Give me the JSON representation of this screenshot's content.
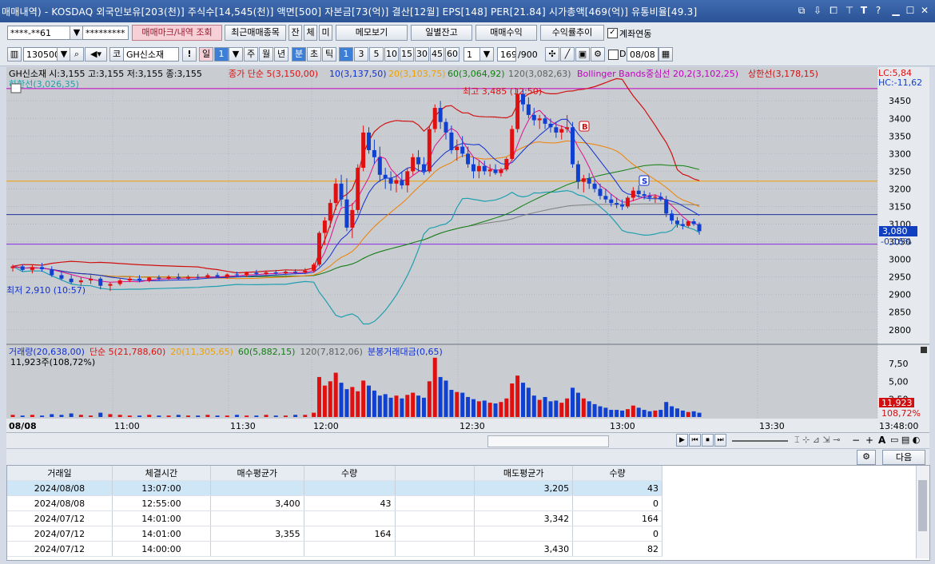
{
  "titlebar": {
    "text": "매매내역) - KOSDAQ 외국인보유[203(천)] 주식수[14,545(천)] 액면[500] 자본금[73(억)] 결산[12월] EPS[148] PER[21.84] 시가총액[469(억)] 유통비율[49.3]"
  },
  "toolbar1": {
    "account_no": "****-**61",
    "password": "*********",
    "btn_trade_mark": "매매마크/내역 조회",
    "btn_recent": "최근매매종목",
    "btn_jan": "잔",
    "btn_che": "체",
    "btn_mi": "미",
    "btn_memo": "메모보기",
    "btn_daily": "일별잔고",
    "btn_profit": "매매수익",
    "btn_trend": "수익률추이",
    "chk_link": "계좌연동"
  },
  "toolbar2": {
    "code": "130500",
    "market": "코",
    "name": "GH신소재",
    "exclam": "!",
    "period_day": "일",
    "period_num": "1",
    "periods": [
      "주",
      "월",
      "년",
      "분",
      "초",
      "틱"
    ],
    "minutes": [
      "1",
      "3",
      "5",
      "10",
      "15",
      "30",
      "45",
      "60"
    ],
    "interval": "1",
    "count": "169",
    "count_total": "/900",
    "chk_d": "D",
    "date": "08/08"
  },
  "chart_header": {
    "name": "GH신소재",
    "ohlc": "시:3,155 고:3,155 저:3,155 종:3,155",
    "ma5": "종가 단순 5(3,150,00)",
    "ma10": "10(3,137,50)",
    "ma20": "20(3,103,75)",
    "ma60": "60(3,064,92)",
    "ma120": "120(3,082,63)",
    "bb": "Bollinger Bands중심선 20,2(3,102,25)",
    "upper_limit": "상한선(3,178,15)",
    "lower_limit": "하한선(3,026,35)",
    "lc": "LC:5,84",
    "hc": "HC:-11,62",
    "high_label": "최고 3,485 (12:50)",
    "low_label": "최저 2,910 (10:57)",
    "buy_mark": "B",
    "sell_mark": "S",
    "current_price": "3,080",
    "current_change": "-0,16%"
  },
  "volume_header": {
    "volume": "거래량(20,638,00)",
    "vma5": "단순 5(21,788,60)",
    "vma20": "20(11,305,65)",
    "vma60": "60(5,882,15)",
    "vma120": "120(7,812,06)",
    "amount": "분봉거래대금(0,65)",
    "sub": "11,923주(108,72%)",
    "current_vol": "11,923",
    "current_ratio": "108,72%"
  },
  "chart_data": {
    "type": "candlestick",
    "date_label": "08/08",
    "x_ticks": [
      "11:00",
      "11:30",
      "12:00",
      "12:30",
      "13:00",
      "13:30",
      "13:48:00"
    ],
    "y_ticks": [
      3450,
      3400,
      3350,
      3300,
      3250,
      3200,
      3150,
      3100,
      3050,
      3000,
      2950,
      2900,
      2850,
      2800
    ],
    "y_range": [
      2770,
      3505
    ],
    "vol_ticks": [
      "7,50",
      "5,00",
      "2,50"
    ],
    "vol_range": [
      0,
      8.5
    ],
    "hlines": [
      {
        "value": 3485,
        "color": "#c000c0"
      },
      {
        "value": 3222,
        "color": "#f0a000"
      },
      {
        "value": 3127,
        "color": "#2030a0"
      },
      {
        "value": 3043,
        "color": "#8a2be2"
      }
    ],
    "ohlc": [
      [
        2975,
        2985,
        2965,
        2980
      ],
      [
        2980,
        2985,
        2965,
        2970
      ],
      [
        2970,
        2985,
        2960,
        2978
      ],
      [
        2978,
        2990,
        2965,
        2972
      ],
      [
        2972,
        2980,
        2950,
        2955
      ],
      [
        2955,
        2965,
        2940,
        2945
      ],
      [
        2945,
        2955,
        2930,
        2935
      ],
      [
        2935,
        2950,
        2925,
        2940
      ],
      [
        2940,
        2955,
        2930,
        2945
      ],
      [
        2945,
        2950,
        2915,
        2925
      ],
      [
        2925,
        2935,
        2910,
        2930
      ],
      [
        2930,
        2945,
        2925,
        2940
      ],
      [
        2940,
        2950,
        2935,
        2945
      ],
      [
        2945,
        2955,
        2935,
        2940
      ],
      [
        2940,
        2950,
        2935,
        2948
      ],
      [
        2948,
        2955,
        2940,
        2945
      ],
      [
        2945,
        2955,
        2940,
        2950
      ],
      [
        2950,
        2960,
        2940,
        2945
      ],
      [
        2945,
        2955,
        2940,
        2950
      ],
      [
        2950,
        2958,
        2942,
        2948
      ],
      [
        2948,
        2960,
        2945,
        2955
      ],
      [
        2955,
        2962,
        2948,
        2950
      ],
      [
        2950,
        2960,
        2945,
        2957
      ],
      [
        2957,
        2965,
        2950,
        2955
      ],
      [
        2955,
        2965,
        2950,
        2962
      ],
      [
        2962,
        2970,
        2955,
        2958
      ],
      [
        2958,
        2968,
        2952,
        2963
      ],
      [
        2963,
        2970,
        2955,
        2960
      ],
      [
        2960,
        2968,
        2955,
        2965
      ],
      [
        2965,
        2972,
        2958,
        2962
      ],
      [
        2962,
        2975,
        2958,
        2968
      ],
      [
        2968,
        2990,
        2962,
        2985
      ],
      [
        2985,
        3080,
        2980,
        3075
      ],
      [
        3075,
        3120,
        3040,
        3110
      ],
      [
        3110,
        3170,
        3090,
        3160
      ],
      [
        3160,
        3230,
        3140,
        3215
      ],
      [
        3215,
        3240,
        3150,
        3170
      ],
      [
        3170,
        3230,
        3080,
        3090
      ],
      [
        3090,
        3160,
        3060,
        3140
      ],
      [
        3140,
        3270,
        3130,
        3260
      ],
      [
        3260,
        3380,
        3250,
        3360
      ],
      [
        3360,
        3375,
        3300,
        3310
      ],
      [
        3310,
        3340,
        3270,
        3290
      ],
      [
        3290,
        3320,
        3220,
        3240
      ],
      [
        3240,
        3260,
        3200,
        3230
      ],
      [
        3230,
        3250,
        3195,
        3215
      ],
      [
        3215,
        3240,
        3190,
        3225
      ],
      [
        3225,
        3250,
        3200,
        3210
      ],
      [
        3210,
        3260,
        3190,
        3250
      ],
      [
        3250,
        3300,
        3240,
        3290
      ],
      [
        3290,
        3310,
        3250,
        3270
      ],
      [
        3270,
        3290,
        3240,
        3250
      ],
      [
        3250,
        3380,
        3245,
        3370
      ],
      [
        3370,
        3440,
        3360,
        3430
      ],
      [
        3430,
        3450,
        3370,
        3390
      ],
      [
        3390,
        3400,
        3340,
        3360
      ],
      [
        3360,
        3380,
        3300,
        3310
      ],
      [
        3310,
        3340,
        3280,
        3320
      ],
      [
        3320,
        3350,
        3290,
        3300
      ],
      [
        3300,
        3320,
        3260,
        3270
      ],
      [
        3270,
        3290,
        3230,
        3250
      ],
      [
        3250,
        3280,
        3230,
        3265
      ],
      [
        3265,
        3280,
        3240,
        3250
      ],
      [
        3250,
        3270,
        3235,
        3255
      ],
      [
        3255,
        3270,
        3240,
        3245
      ],
      [
        3245,
        3260,
        3235,
        3255
      ],
      [
        3255,
        3290,
        3250,
        3285
      ],
      [
        3285,
        3380,
        3280,
        3370
      ],
      [
        3370,
        3485,
        3360,
        3470
      ],
      [
        3470,
        3485,
        3420,
        3440
      ],
      [
        3440,
        3460,
        3400,
        3410
      ],
      [
        3410,
        3430,
        3380,
        3395
      ],
      [
        3395,
        3410,
        3370,
        3400
      ],
      [
        3400,
        3410,
        3370,
        3385
      ],
      [
        3385,
        3400,
        3360,
        3375
      ],
      [
        3375,
        3390,
        3345,
        3360
      ],
      [
        3360,
        3380,
        3340,
        3370
      ],
      [
        3370,
        3410,
        3360,
        3375
      ],
      [
        3375,
        3390,
        3260,
        3270
      ],
      [
        3270,
        3280,
        3200,
        3220
      ],
      [
        3220,
        3240,
        3190,
        3230
      ],
      [
        3230,
        3245,
        3200,
        3215
      ],
      [
        3215,
        3230,
        3190,
        3200
      ],
      [
        3200,
        3215,
        3170,
        3180
      ],
      [
        3180,
        3200,
        3160,
        3170
      ],
      [
        3170,
        3185,
        3150,
        3160
      ],
      [
        3160,
        3175,
        3145,
        3155
      ],
      [
        3155,
        3170,
        3140,
        3150
      ],
      [
        3150,
        3180,
        3145,
        3175
      ],
      [
        3175,
        3205,
        3165,
        3195
      ],
      [
        3195,
        3210,
        3175,
        3185
      ],
      [
        3185,
        3195,
        3170,
        3180
      ],
      [
        3180,
        3190,
        3165,
        3175
      ],
      [
        3175,
        3185,
        3160,
        3178
      ],
      [
        3178,
        3190,
        3165,
        3170
      ],
      [
        3170,
        3180,
        3120,
        3130
      ],
      [
        3130,
        3140,
        3100,
        3110
      ],
      [
        3110,
        3120,
        3090,
        3100
      ],
      [
        3100,
        3115,
        3085,
        3095
      ],
      [
        3095,
        3110,
        3090,
        3108
      ],
      [
        3108,
        3115,
        3095,
        3100
      ],
      [
        3100,
        3105,
        3070,
        3080
      ]
    ],
    "volume": [
      0.3,
      0.2,
      0.3,
      0.2,
      0.4,
      0.3,
      0.5,
      0.3,
      0.2,
      0.6,
      0.4,
      0.3,
      0.2,
      0.2,
      0.3,
      0.2,
      0.2,
      0.3,
      0.2,
      0.2,
      0.3,
      0.2,
      0.2,
      0.3,
      0.2,
      0.2,
      0.3,
      0.2,
      0.2,
      0.3,
      0.3,
      0.6,
      5.6,
      4.4,
      5.0,
      6.2,
      4.8,
      3.9,
      4.2,
      3.6,
      5.1,
      4.4,
      3.7,
      3.0,
      3.2,
      2.7,
      3.0,
      2.6,
      3.1,
      3.4,
      3.0,
      2.7,
      5.0,
      8.3,
      5.6,
      5.1,
      3.8,
      3.5,
      3.4,
      2.8,
      2.5,
      2.2,
      2.3,
      2.0,
      1.9,
      2.1,
      2.6,
      4.7,
      5.8,
      4.8,
      4.1,
      3.0,
      2.4,
      2.8,
      2.2,
      2.3,
      2.0,
      2.6,
      4.1,
      3.4,
      2.6,
      2.2,
      1.8,
      1.5,
      1.3,
      1.0,
      1.0,
      0.9,
      1.1,
      1.6,
      1.3,
      1.0,
      0.8,
      0.9,
      1.0,
      2.1,
      1.5,
      1.2,
      0.9,
      0.7,
      0.8,
      0.6
    ]
  },
  "scrollbar": {
    "buttons": [
      "▶",
      "⏮",
      "⏹",
      "⏭"
    ],
    "right_tools": [
      "+",
      "A"
    ]
  },
  "bottom": {
    "next": "다음"
  },
  "table": {
    "headers": [
      "거래일",
      "체결시간",
      "매수평균가",
      "수량",
      "",
      "매도평균가",
      "수량"
    ],
    "rows": [
      [
        "2024/08/08",
        "13:07:00",
        "",
        "",
        "",
        "3,205",
        "43"
      ],
      [
        "2024/08/08",
        "12:55:00",
        "3,400",
        "43",
        "",
        "",
        "0"
      ],
      [
        "2024/07/12",
        "14:01:00",
        "",
        "",
        "",
        "3,342",
        "164"
      ],
      [
        "2024/07/12",
        "14:01:00",
        "3,355",
        "164",
        "",
        "",
        "0"
      ],
      [
        "2024/07/12",
        "14:00:00",
        "",
        "",
        "",
        "3,430",
        "82"
      ]
    ]
  }
}
